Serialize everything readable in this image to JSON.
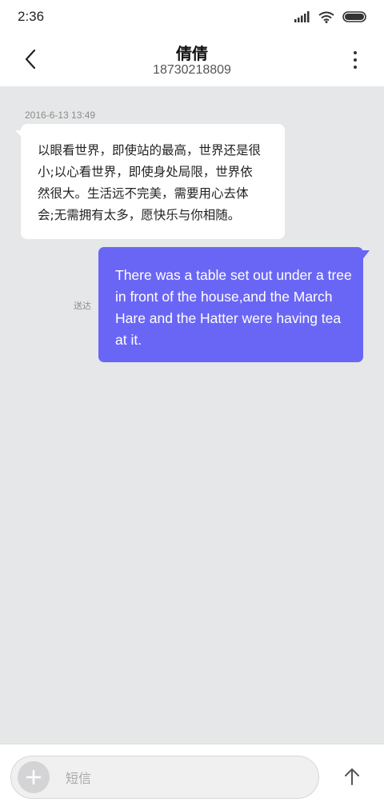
{
  "status_bar": {
    "time": "2:36",
    "icons": [
      "signal-icon",
      "wifi-icon",
      "battery-icon"
    ]
  },
  "header": {
    "contact_name": "倩倩",
    "contact_number": "18730218809",
    "back_icon": "back-arrow-icon",
    "menu_icon": "more-vertical-icon"
  },
  "conversation": {
    "timestamp": "2016-6-13 13:49",
    "messages": [
      {
        "direction": "incoming",
        "lines": [
          "以眼看世界，即使站的最高，世界还是很",
          "小;以心看世界，即使身处局限，世界依",
          "然很大。生活远不完美，需要用心去体",
          "会;无需拥有太多，愿快乐与你相随。"
        ]
      },
      {
        "direction": "outgoing",
        "lines": [
          "There was a table set out under a tree",
          "in front of the house,and the March",
          "Hare and the Hatter were having tea",
          "at it."
        ],
        "status": "送达"
      }
    ]
  },
  "composer": {
    "placeholder": "短信",
    "value": "",
    "attach_icon": "plus-icon",
    "send_icon": "send-arrow-up-icon"
  },
  "colors": {
    "outgoing_bubble": "#6a66f5",
    "incoming_bubble": "#ffffff",
    "background": "#e6e7e8"
  }
}
